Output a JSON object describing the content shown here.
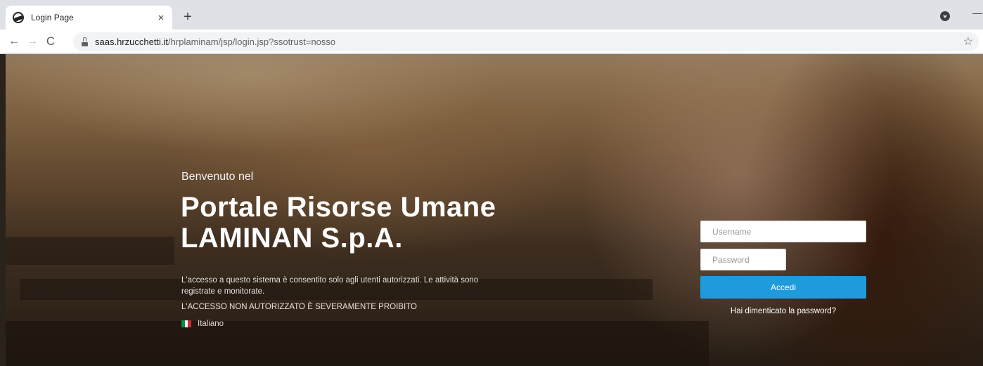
{
  "browser": {
    "tab_title": "Login Page",
    "tab_close": "×",
    "new_tab": "+",
    "url_host": "saas.hrzucchetti.it",
    "url_path": "/hrplaminam/jsp/login.jsp?ssotrust=nosso",
    "back": "←",
    "forward": "→",
    "reload": "C",
    "bookmark": "☆",
    "minimize": "—"
  },
  "hero": {
    "welcome": "Benvenuto nel",
    "title_line1": "Portale Risorse Umane",
    "title_line2": "LAMINAN S.p.A.",
    "notice": "L'accesso a questo sistema è consentito solo agli utenti autorizzati. Le attività sono registrate e monitorate.",
    "notice_strong": "L'ACCESSO NON AUTORIZZATO È SEVERAMENTE PROIBITO",
    "language": "Italiano",
    "flag_colors": [
      "#009246",
      "#ffffff",
      "#ce2b37"
    ]
  },
  "login": {
    "username_placeholder": "Username",
    "password_placeholder": "Password",
    "submit_label": "Accedi",
    "forgot_label": "Hai dimenticato la password?",
    "accent": "#1e9bdb"
  }
}
